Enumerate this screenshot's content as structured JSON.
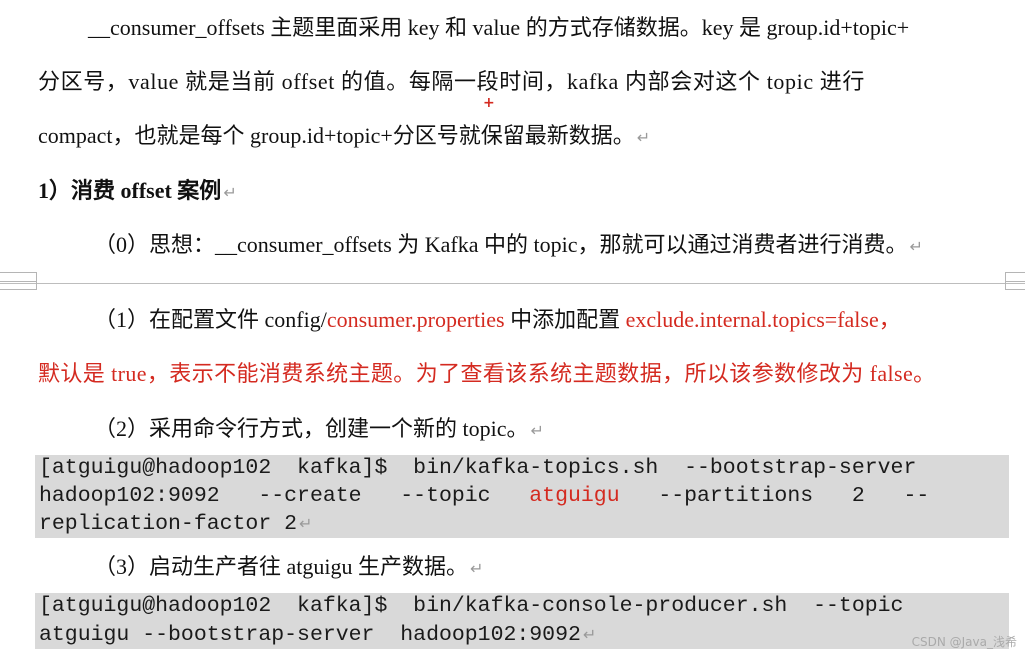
{
  "paragraphs": {
    "p1": {
      "l1": "__consumer_offsets 主题里面采用 key 和 value 的方式存储数据。key 是 group.id+topic+",
      "l2": "分区号，value 就是当前 offset 的值。每隔一段时间，kafka 内部会对这个 topic 进行",
      "l3": "compact，也就是每个 group.id+topic+分区号就保留最新数据。"
    },
    "heading": "1）消费 offset 案例",
    "step0": "（0）思想：__consumer_offsets 为 Kafka 中的 topic，那就可以通过消费者进行消费。",
    "step1": {
      "prefix": "（1）在配置文件 config/",
      "file": "consumer.properties",
      "middle": " 中添加配置 ",
      "config": "exclude.internal.topics=false，",
      "l2": "默认是 true，表示不能消费系统主题。为了查看该系统主题数据，所以该参数修改为 false。"
    },
    "step2": "（2）采用命令行方式，创建一个新的 topic。",
    "code1": {
      "l1": "[atguigu@hadoop102  kafka]$  bin/kafka-topics.sh  --bootstrap-server",
      "l2a": "hadoop102:9092   --create   --topic   ",
      "l2b": "atguigu",
      "l2c": "   --partitions   2   --",
      "l3": "replication-factor 2"
    },
    "step3": "（3）启动生产者往 atguigu 生产数据。",
    "code2": {
      "l1": "[atguigu@hadoop102  kafka]$  bin/kafka-console-producer.sh  --topic",
      "l2": "atguigu --bootstrap-server  hadoop102:9092"
    },
    "paragraph_mark": "↵",
    "insert_marker": "+",
    "watermark": "CSDN @Java_浅希"
  }
}
